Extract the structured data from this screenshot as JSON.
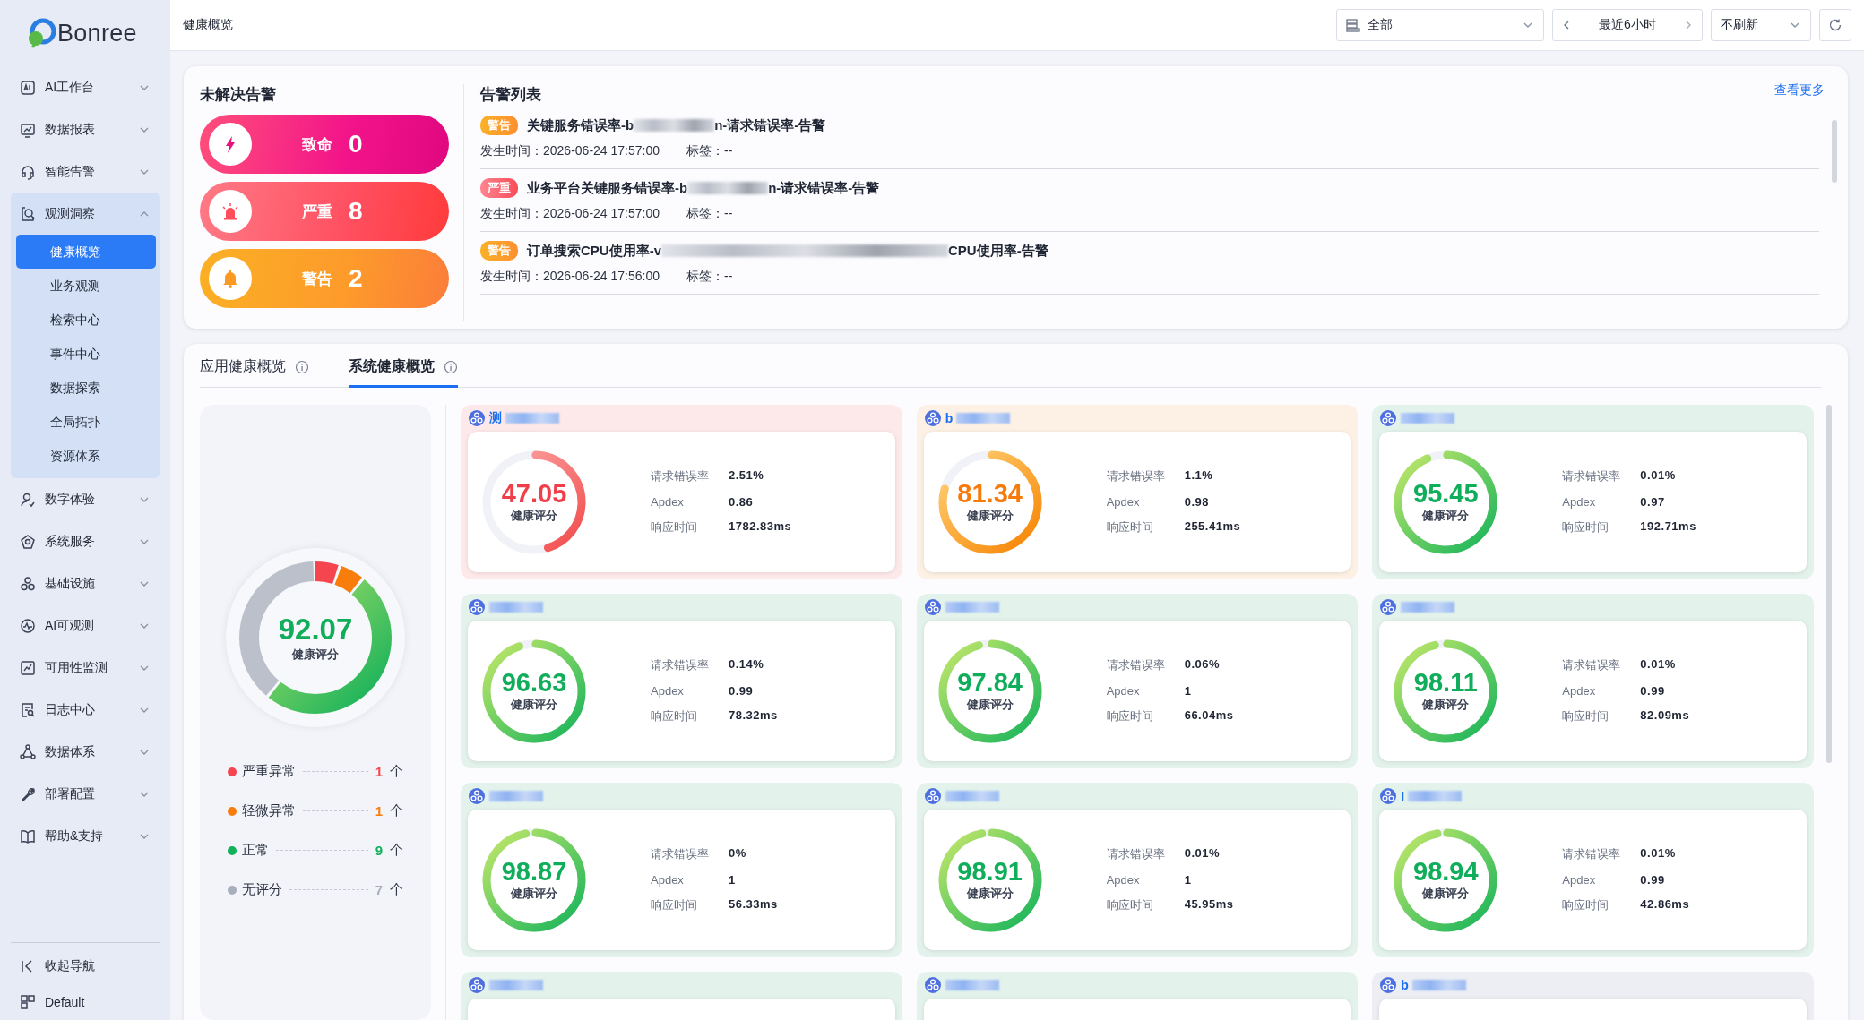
{
  "sidebar": {
    "logo": "Bonree",
    "items": [
      {
        "label": "AI工作台",
        "expanded": false
      },
      {
        "label": "数据报表",
        "expanded": false
      },
      {
        "label": "智能告警",
        "expanded": false
      },
      {
        "label": "观测洞察",
        "expanded": true,
        "children": [
          {
            "label": "健康概览",
            "selected": true
          },
          {
            "label": "业务观测",
            "selected": false
          },
          {
            "label": "检索中心",
            "selected": false
          },
          {
            "label": "事件中心",
            "selected": false
          },
          {
            "label": "数据探索",
            "selected": false
          },
          {
            "label": "全局拓扑",
            "selected": false
          },
          {
            "label": "资源体系",
            "selected": false
          }
        ]
      },
      {
        "label": "数字体验",
        "expanded": false
      },
      {
        "label": "系统服务",
        "expanded": false
      },
      {
        "label": "基础设施",
        "expanded": false
      },
      {
        "label": "AI可观测",
        "expanded": false
      },
      {
        "label": "可用性监测",
        "expanded": false
      },
      {
        "label": "日志中心",
        "expanded": false
      },
      {
        "label": "数据体系",
        "expanded": false
      },
      {
        "label": "部署配置",
        "expanded": false
      },
      {
        "label": "帮助&支持",
        "expanded": false
      }
    ],
    "footer": [
      "收起导航",
      "Default"
    ]
  },
  "topbar": {
    "title": "健康概览",
    "scope": "全部",
    "time_range": "最近6小时",
    "refresh": "不刷新"
  },
  "alerts": {
    "summary_title": "未解决告警",
    "summary": [
      {
        "kind": "fatal",
        "label": "致命",
        "count": "0"
      },
      {
        "kind": "critical",
        "label": "严重",
        "count": "8"
      },
      {
        "kind": "warning",
        "label": "警告",
        "count": "2"
      }
    ],
    "list_title": "告警列表",
    "more": "查看更多",
    "items": [
      {
        "kind": "warning",
        "tag": "警告",
        "title_start": "关键服务错误率-b",
        "title_end": "n-请求错误率-告警",
        "time_label": "发生时间：",
        "time": "2026-06-24 17:57:00",
        "tags_label": "标签：",
        "tags": "--"
      },
      {
        "kind": "critical",
        "tag": "严重",
        "title_start": "业务平台关键服务错误率-b",
        "title_end": "n-请求错误率-告警",
        "time_label": "发生时间：",
        "time": "2026-06-24 17:57:00",
        "tags_label": "标签：",
        "tags": "--"
      },
      {
        "kind": "warning",
        "tag": "警告",
        "title_start": "订单搜索CPU使用率-v",
        "title_end": "CPU使用率-告警",
        "time_label": "发生时间：",
        "time": "2026-06-24 17:56:00",
        "tags_label": "标签：",
        "tags": "--"
      }
    ]
  },
  "health": {
    "tabs": [
      {
        "label": "应用健康概览",
        "selected": false
      },
      {
        "label": "系统健康概览",
        "selected": true
      }
    ],
    "overall": {
      "score": "92.07",
      "score_label": "健康评分",
      "legend": [
        {
          "label": "严重异常",
          "count": "1",
          "unit": "个",
          "color": "#f5464f"
        },
        {
          "label": "轻微异常",
          "count": "1",
          "unit": "个",
          "color": "#f97d0b"
        },
        {
          "label": "正常",
          "count": "9",
          "unit": "个",
          "color": "#12b05a"
        },
        {
          "label": "无评分",
          "count": "7",
          "unit": "个",
          "color": "#a8aebb"
        }
      ]
    },
    "cards": [
      {
        "kind": "critical",
        "name": "测",
        "score": "47.05",
        "level": 0.4705,
        "score_label": "健康评分",
        "metrics": [
          {
            "label": "请求错误率",
            "value": "2.51%"
          },
          {
            "label": "Apdex",
            "value": "0.86"
          },
          {
            "label": "响应时间",
            "value": "1782.83ms"
          }
        ]
      },
      {
        "kind": "minor",
        "name": "b",
        "score": "81.34",
        "level": 0.8134,
        "score_label": "健康评分",
        "metrics": [
          {
            "label": "请求错误率",
            "value": "1.1%"
          },
          {
            "label": "Apdex",
            "value": "0.98"
          },
          {
            "label": "响应时间",
            "value": "255.41ms"
          }
        ]
      },
      {
        "kind": "normal",
        "score": "95.45",
        "level": 0.9545,
        "score_label": "健康评分",
        "metrics": [
          {
            "label": "请求错误率",
            "value": "0.01%"
          },
          {
            "label": "Apdex",
            "value": "0.97"
          },
          {
            "label": "响应时间",
            "value": "192.71ms"
          }
        ]
      },
      {
        "kind": "normal",
        "score": "96.63",
        "level": 0.9663,
        "score_label": "健康评分",
        "metrics": [
          {
            "label": "请求错误率",
            "value": "0.14%"
          },
          {
            "label": "Apdex",
            "value": "0.99"
          },
          {
            "label": "响应时间",
            "value": "78.32ms"
          }
        ]
      },
      {
        "kind": "normal",
        "score": "97.84",
        "level": 0.9784,
        "score_label": "健康评分",
        "metrics": [
          {
            "label": "请求错误率",
            "value": "0.06%"
          },
          {
            "label": "Apdex",
            "value": "1"
          },
          {
            "label": "响应时间",
            "value": "66.04ms"
          }
        ]
      },
      {
        "kind": "normal",
        "score": "98.11",
        "level": 0.9811,
        "score_label": "健康评分",
        "metrics": [
          {
            "label": "请求错误率",
            "value": "0.01%"
          },
          {
            "label": "Apdex",
            "value": "0.99"
          },
          {
            "label": "响应时间",
            "value": "82.09ms"
          }
        ]
      },
      {
        "kind": "normal",
        "score": "98.87",
        "level": 0.9887,
        "score_label": "健康评分",
        "metrics": [
          {
            "label": "请求错误率",
            "value": "0%"
          },
          {
            "label": "Apdex",
            "value": "1"
          },
          {
            "label": "响应时间",
            "value": "56.33ms"
          }
        ]
      },
      {
        "kind": "normal",
        "score": "98.91",
        "level": 0.9891,
        "score_label": "健康评分",
        "metrics": [
          {
            "label": "请求错误率",
            "value": "0.01%"
          },
          {
            "label": "Apdex",
            "value": "1"
          },
          {
            "label": "响应时间",
            "value": "45.95ms"
          }
        ]
      },
      {
        "kind": "normal",
        "name": "I",
        "score": "98.94",
        "level": 0.9894,
        "score_label": "健康评分",
        "metrics": [
          {
            "label": "请求错误率",
            "value": "0.01%"
          },
          {
            "label": "Apdex",
            "value": "0.99"
          },
          {
            "label": "响应时间",
            "value": "42.86ms"
          }
        ]
      },
      {
        "kind": "normal"
      },
      {
        "kind": "normal"
      },
      {
        "kind": "none",
        "name": "b"
      }
    ]
  }
}
